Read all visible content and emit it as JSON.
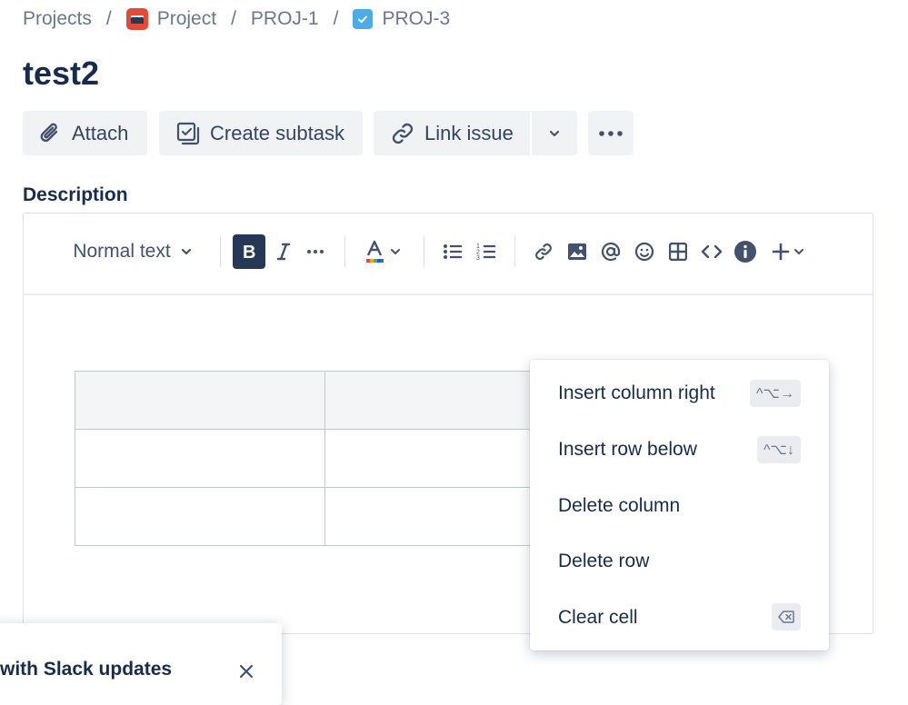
{
  "breadcrumb": {
    "projects": "Projects",
    "separator": "/",
    "project": "Project",
    "parent": "PROJ-1",
    "current": "PROJ-3"
  },
  "issue": {
    "title": "test2"
  },
  "actions": {
    "attach": "Attach",
    "create_subtask": "Create subtask",
    "link_issue": "Link issue"
  },
  "description": {
    "label": "Description",
    "toolbar": {
      "text_style": "Normal text"
    }
  },
  "table_menu": {
    "items": [
      {
        "label": "Insert column right",
        "shortcut": "^⌥→"
      },
      {
        "label": "Insert row below",
        "shortcut": "^⌥↓"
      },
      {
        "label": "Delete column",
        "shortcut": ""
      },
      {
        "label": "Delete row",
        "shortcut": ""
      },
      {
        "label": "Clear cell",
        "shortcut": "⌫"
      }
    ]
  },
  "flag": {
    "text": "with Slack updates"
  },
  "colors": {
    "text": "#172b4d",
    "muted": "#42526e",
    "button_bg": "#f1f2f4",
    "bold_active": "#253858"
  }
}
